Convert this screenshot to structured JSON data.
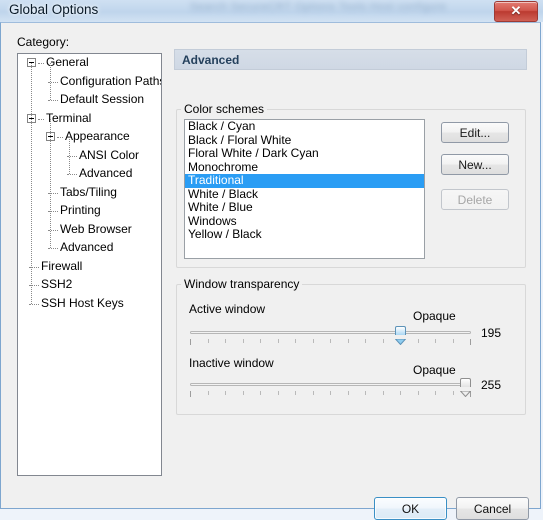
{
  "window": {
    "title": "Global Options",
    "close_label": "✕",
    "background_blur_text": "Search SecureCRT   Options   Tools   Host   configure"
  },
  "category": {
    "label": "Category:",
    "tree": [
      {
        "label": "General",
        "depth": 0,
        "expander": "minus"
      },
      {
        "label": "Configuration Paths",
        "depth": 1,
        "expander": "leaf"
      },
      {
        "label": "Default Session",
        "depth": 1,
        "expander": "leaf"
      },
      {
        "label": "Terminal",
        "depth": 0,
        "expander": "minus"
      },
      {
        "label": "Appearance",
        "depth": 1,
        "expander": "minus"
      },
      {
        "label": "ANSI Color",
        "depth": 2,
        "expander": "leaf"
      },
      {
        "label": "Advanced",
        "depth": 2,
        "expander": "leaf"
      },
      {
        "label": "Tabs/Tiling",
        "depth": 1,
        "expander": "leaf"
      },
      {
        "label": "Printing",
        "depth": 1,
        "expander": "leaf"
      },
      {
        "label": "Web Browser",
        "depth": 1,
        "expander": "leaf"
      },
      {
        "label": "Advanced",
        "depth": 1,
        "expander": "leaf"
      },
      {
        "label": "Firewall",
        "depth": 0,
        "expander": "leaf"
      },
      {
        "label": "SSH2",
        "depth": 0,
        "expander": "leaf"
      },
      {
        "label": "SSH Host Keys",
        "depth": 0,
        "expander": "leaf"
      }
    ]
  },
  "page": {
    "header": "Advanced"
  },
  "color_schemes": {
    "group_title": "Color schemes",
    "items": [
      "Black / Cyan",
      "Black / Floral White",
      "Floral White / Dark Cyan",
      "Monochrome",
      "Traditional",
      "White / Black",
      "White / Blue",
      "Windows",
      "Yellow / Black"
    ],
    "selected": "Traditional",
    "selected_index": 4,
    "selection_color": "#2a9df4",
    "buttons": {
      "edit": "Edit...",
      "new": "New...",
      "delete": "Delete",
      "delete_enabled": false
    }
  },
  "transparency": {
    "group_title": "Window transparency",
    "sliders": [
      {
        "caption": "Active window",
        "opaque_label": "Opaque",
        "value": "195",
        "percent": 76,
        "thumb_style": "blue"
      },
      {
        "caption": "Inactive window",
        "opaque_label": "Opaque",
        "value": "255",
        "percent": 100,
        "thumb_style": "gray"
      }
    ]
  },
  "footer": {
    "ok": "OK",
    "cancel": "Cancel"
  }
}
